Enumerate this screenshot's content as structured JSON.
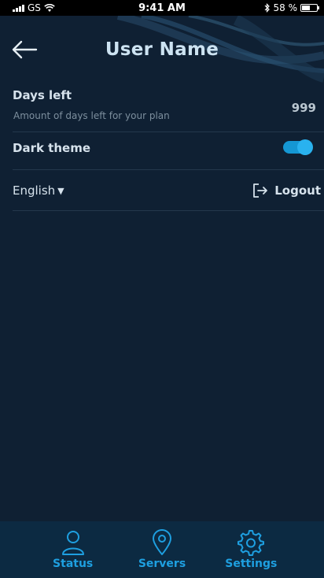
{
  "status_bar": {
    "carrier": "GS",
    "time": "9:41 AM",
    "battery_percent": "58 %",
    "battery_level": 0.58
  },
  "header": {
    "title": "User Name",
    "back_icon": "arrow-left-icon"
  },
  "account": {
    "days_left_label": "Days left",
    "days_left_description": "Amount of days left for your plan",
    "days_left_value": "999"
  },
  "appearance": {
    "dark_theme_label": "Dark theme",
    "dark_theme_enabled": true
  },
  "footer_row": {
    "language": "English",
    "logout_label": "Logout"
  },
  "tab_bar": {
    "tabs": [
      {
        "label": "Status",
        "icon": "user-icon"
      },
      {
        "label": "Servers",
        "icon": "map-pin-icon"
      },
      {
        "label": "Settings",
        "icon": "gear-icon"
      }
    ]
  },
  "colors": {
    "background": "#0f2033",
    "accent": "#1e9fe0",
    "tab_bar": "#0c2a42"
  }
}
